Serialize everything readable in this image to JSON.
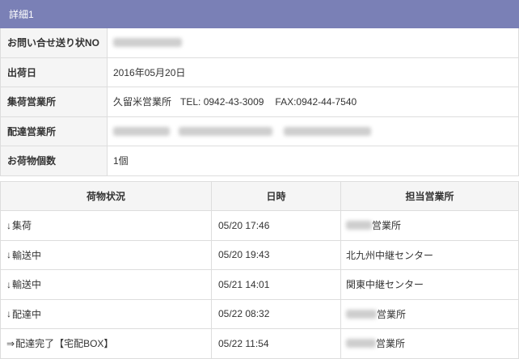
{
  "panel": {
    "title": "詳細1"
  },
  "details": {
    "tracking_number": {
      "label": "お問い合せ送り状NO"
    },
    "ship_date": {
      "label": "出荷日",
      "value": "2016年05月20日"
    },
    "pickup_office": {
      "label": "集荷営業所",
      "name": "久留米営業所",
      "tel": "TEL: 0942-43-3009",
      "fax": "FAX:0942-44-7540"
    },
    "delivery_office": {
      "label": "配達営業所"
    },
    "package_count": {
      "label": "お荷物個数",
      "value": "1個"
    }
  },
  "tracking": {
    "headers": {
      "status": "荷物状況",
      "datetime": "日時",
      "office": "担当営業所"
    },
    "rows": [
      {
        "icon": "down-arrow-icon",
        "arrow": "↓",
        "status": "集荷",
        "datetime": "05/20 17:46",
        "office": "営業所"
      },
      {
        "icon": "down-arrow-icon",
        "arrow": "↓",
        "status": "輸送中",
        "datetime": "05/20 19:43",
        "office": "北九州中継センター"
      },
      {
        "icon": "down-arrow-icon",
        "arrow": "↓",
        "status": "輸送中",
        "datetime": "05/21 14:01",
        "office": "関東中継センター"
      },
      {
        "icon": "down-arrow-icon",
        "arrow": "↓",
        "status": "配達中",
        "datetime": "05/22 08:32",
        "office": "営業所"
      },
      {
        "icon": "right-double-arrow-icon",
        "arrow": "⇒",
        "status": "配達完了【宅配BOX】",
        "datetime": "05/22 11:54",
        "office": "営業所"
      }
    ]
  },
  "colors": {
    "accent": "#7a80b6",
    "cell_bg": "#f5f5f5",
    "border": "#dddddd",
    "text": "#333333"
  }
}
